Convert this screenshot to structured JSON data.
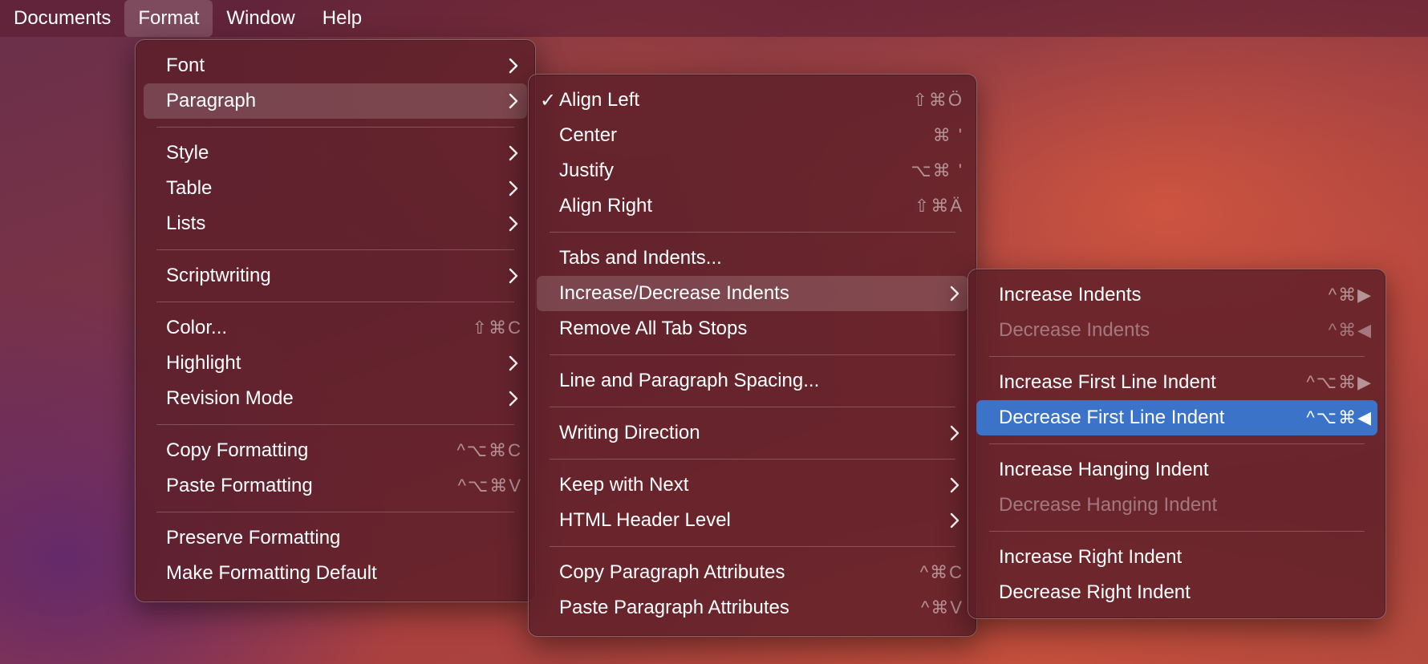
{
  "menubar": {
    "items": [
      "Documents",
      "Format",
      "Window",
      "Help"
    ]
  },
  "format_menu": {
    "items": [
      {
        "label": "Font",
        "submenu": true
      },
      {
        "label": "Paragraph",
        "submenu": true
      },
      {
        "label": "Style",
        "submenu": true
      },
      {
        "label": "Table",
        "submenu": true
      },
      {
        "label": "Lists",
        "submenu": true
      },
      {
        "label": "Scriptwriting",
        "submenu": true
      },
      {
        "label": "Color...",
        "shortcut": "⇧⌘C"
      },
      {
        "label": "Highlight",
        "submenu": true
      },
      {
        "label": "Revision Mode",
        "submenu": true
      },
      {
        "label": "Copy Formatting",
        "shortcut": "^⌥⌘C"
      },
      {
        "label": "Paste Formatting",
        "shortcut": "^⌥⌘V"
      },
      {
        "label": "Preserve Formatting"
      },
      {
        "label": "Make Formatting Default"
      }
    ]
  },
  "paragraph_menu": {
    "items": [
      {
        "label": "Align Left",
        "shortcut": "⇧⌘Ö",
        "checked": true
      },
      {
        "label": "Center",
        "shortcut": "⌘ '"
      },
      {
        "label": "Justify",
        "shortcut": "⌥⌘ '"
      },
      {
        "label": "Align Right",
        "shortcut": "⇧⌘Ä"
      },
      {
        "label": "Tabs and Indents..."
      },
      {
        "label": "Increase/Decrease Indents",
        "submenu": true
      },
      {
        "label": "Remove All Tab Stops"
      },
      {
        "label": "Line and Paragraph Spacing..."
      },
      {
        "label": "Writing Direction",
        "submenu": true
      },
      {
        "label": "Keep with Next",
        "submenu": true
      },
      {
        "label": "HTML Header Level",
        "submenu": true
      },
      {
        "label": "Copy Paragraph Attributes",
        "shortcut": "^⌘C"
      },
      {
        "label": "Paste Paragraph Attributes",
        "shortcut": "^⌘V"
      }
    ]
  },
  "indents_menu": {
    "items": [
      {
        "label": "Increase Indents",
        "shortcut": "^⌘▶"
      },
      {
        "label": "Decrease Indents",
        "shortcut": "^⌘◀",
        "disabled": true
      },
      {
        "label": "Increase First Line Indent",
        "shortcut": "^⌥⌘▶"
      },
      {
        "label": "Decrease First Line Indent",
        "shortcut": "^⌥⌘◀",
        "selected": true
      },
      {
        "label": "Increase Hanging Indent"
      },
      {
        "label": "Decrease Hanging Indent",
        "disabled": true
      },
      {
        "label": "Increase Right Indent"
      },
      {
        "label": "Decrease Right Indent"
      }
    ]
  },
  "colors": {
    "selection": "#3b73c9"
  }
}
